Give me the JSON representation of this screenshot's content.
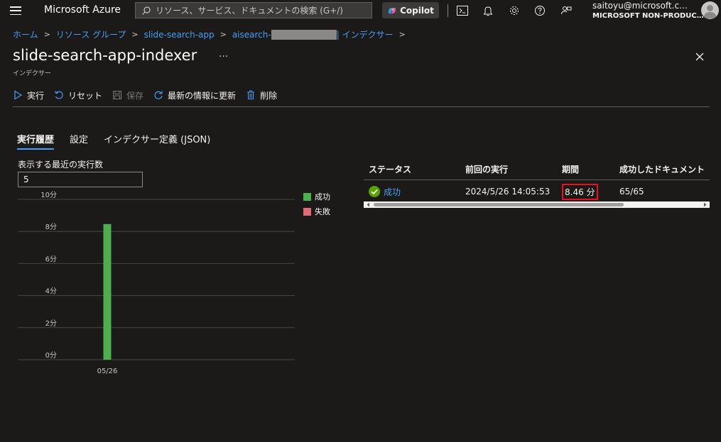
{
  "topbar": {
    "brand": "Microsoft Azure",
    "search_placeholder": "リソース、サービス、ドキュメントの検索 (G+/)",
    "copilot_label": "Copilot",
    "account_email": "saitoyu@microsoft.c…",
    "account_org": "MICROSOFT NON-PRODUC…"
  },
  "breadcrumb": {
    "items": [
      "ホーム",
      "リソース グループ",
      "slide-search-app",
      "aisearch-",
      "| インデクサー"
    ]
  },
  "page": {
    "title": "slide-search-app-indexer",
    "subtitle": "インデクサー",
    "more": "···"
  },
  "toolbar": {
    "run": "実行",
    "reset": "リセット",
    "save": "保存",
    "refresh": "最新の情報に更新",
    "delete": "削除"
  },
  "tabs": {
    "history": "実行履歴",
    "settings": "設定",
    "json": "インデクサー定義 (JSON)"
  },
  "recent": {
    "label": "表示する最近の実行数",
    "value": "5"
  },
  "chart_data": {
    "type": "bar",
    "categories": [
      "05/26"
    ],
    "series": [
      {
        "name": "成功",
        "values": [
          8.46
        ]
      },
      {
        "name": "失敗",
        "values": [
          0
        ]
      }
    ],
    "yticks": [
      "0分",
      "2分",
      "4分",
      "6分",
      "8分",
      "10分"
    ],
    "ylim": [
      0,
      10
    ],
    "colors": {
      "success": "#4caf50",
      "failure": "#e06c75"
    },
    "legend": "right"
  },
  "table": {
    "headers": [
      "ステータス",
      "前回の実行",
      "期間",
      "成功したドキュメント"
    ],
    "rows": [
      {
        "status": "成功",
        "last_run": "2024/5/26 14:05:53",
        "duration": "8.46 分",
        "docs": "65/65"
      }
    ]
  }
}
